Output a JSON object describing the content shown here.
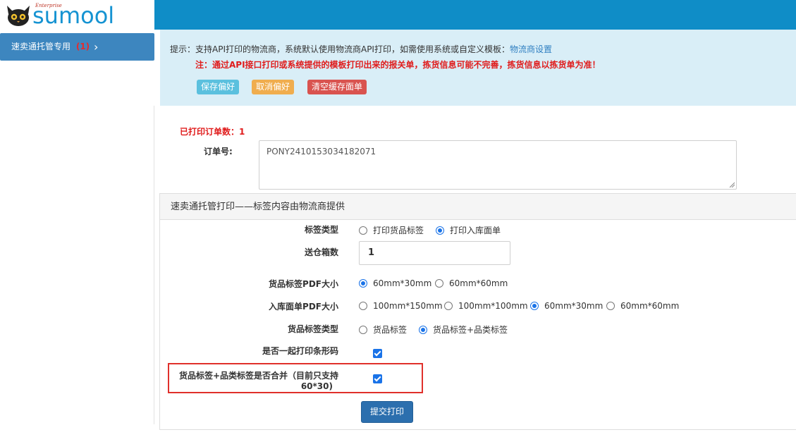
{
  "header": {
    "logo_small": "Enterprise",
    "logo_text": "sumool"
  },
  "sidebar": {
    "item_label": "速卖通托管专用",
    "item_count": "(1)",
    "item_chevron": "›"
  },
  "notice": {
    "line1_text": "提示：支持API打印的物流商，系统默认使用物流商API打印，如需使用系统或自定义模板：",
    "line1_link": "物流商设置",
    "line2_text": "注：通过API接口打印或系统提供的模板打印出来的报关单，拣货信息可能不完善，拣货信息以拣货单为准！",
    "buttons": {
      "save": "保存偏好",
      "cancel": "取消偏好",
      "clear": "清空缓存面单"
    }
  },
  "printed_count_text": "已打印订单数：1",
  "order": {
    "label": "订单号:",
    "value": "PONY2410153034182071"
  },
  "panel": {
    "title": "速卖通托管打印——标签内容由物流商提供",
    "label_type": {
      "label": "标签类型",
      "options": [
        "打印货品标签",
        "打印入库面单"
      ],
      "selected": 1
    },
    "box_count": {
      "label": "送仓箱数",
      "value": "1"
    },
    "goods_pdf_size": {
      "label": "货品标签PDF大小",
      "options": [
        "60mm*30mm",
        "60mm*60mm"
      ],
      "selected": 0
    },
    "inbound_pdf_size": {
      "label": "入库面单PDF大小",
      "options": [
        "100mm*150mm",
        "100mm*100mm",
        "60mm*30mm",
        "60mm*60mm"
      ],
      "selected": 2
    },
    "goods_label_type": {
      "label": "货品标签类型",
      "options": [
        "货品标签",
        "货品标签+品类标签"
      ],
      "selected": 1
    },
    "print_barcode": {
      "label": "是否一起打印条形码",
      "checked": true
    },
    "merge_labels": {
      "label_line1": "货品标签+品类标签是否合并（目前只支持",
      "label_line2": "60*30)",
      "checked": true
    },
    "submit": "提交打印"
  },
  "colors": {
    "topbar": "#0f8dc7",
    "sidebar_item": "#3d86bf",
    "notice_bg": "#d9eef7",
    "alert_red": "#e01c1c",
    "highlight_border": "#e0302b",
    "submit_bg": "#2c6fae"
  }
}
